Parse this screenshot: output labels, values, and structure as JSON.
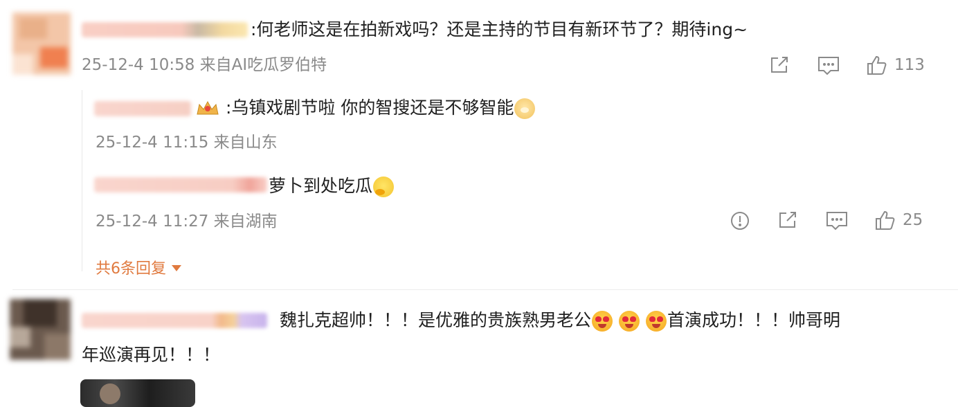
{
  "comments": [
    {
      "text_segments": [
        ":何老师这是在拍新戏吗？还是主持的节目有新环节了？期待ing~"
      ],
      "meta": "25-12-4 10:58 来自AI吃瓜罗伯特",
      "like_count": "113",
      "icons": [
        "share-icon",
        "comment-icon",
        "like-icon"
      ]
    },
    {
      "text": ":乌镇戏剧节啦 你的智搜还是不够智能",
      "meta": "25-12-4 11:15 来自山东"
    },
    {
      "text": "萝卜到处吃瓜",
      "meta": "25-12-4 11:27 来自湖南",
      "like_count": "25",
      "icons": [
        "report-icon",
        "share-icon",
        "comment-icon",
        "like-icon"
      ]
    },
    {
      "more_replies": "共6条回复"
    },
    {
      "line1_a": "魏扎克超帅！！！是优雅的贵族熟男老公",
      "line1_b": "首演成功！！！帅哥明",
      "line2": "年巡演再见！！！"
    }
  ],
  "colors": {
    "accent": "#e07a3f",
    "meta_gray": "#8a8a8a",
    "divider": "#ececec"
  }
}
